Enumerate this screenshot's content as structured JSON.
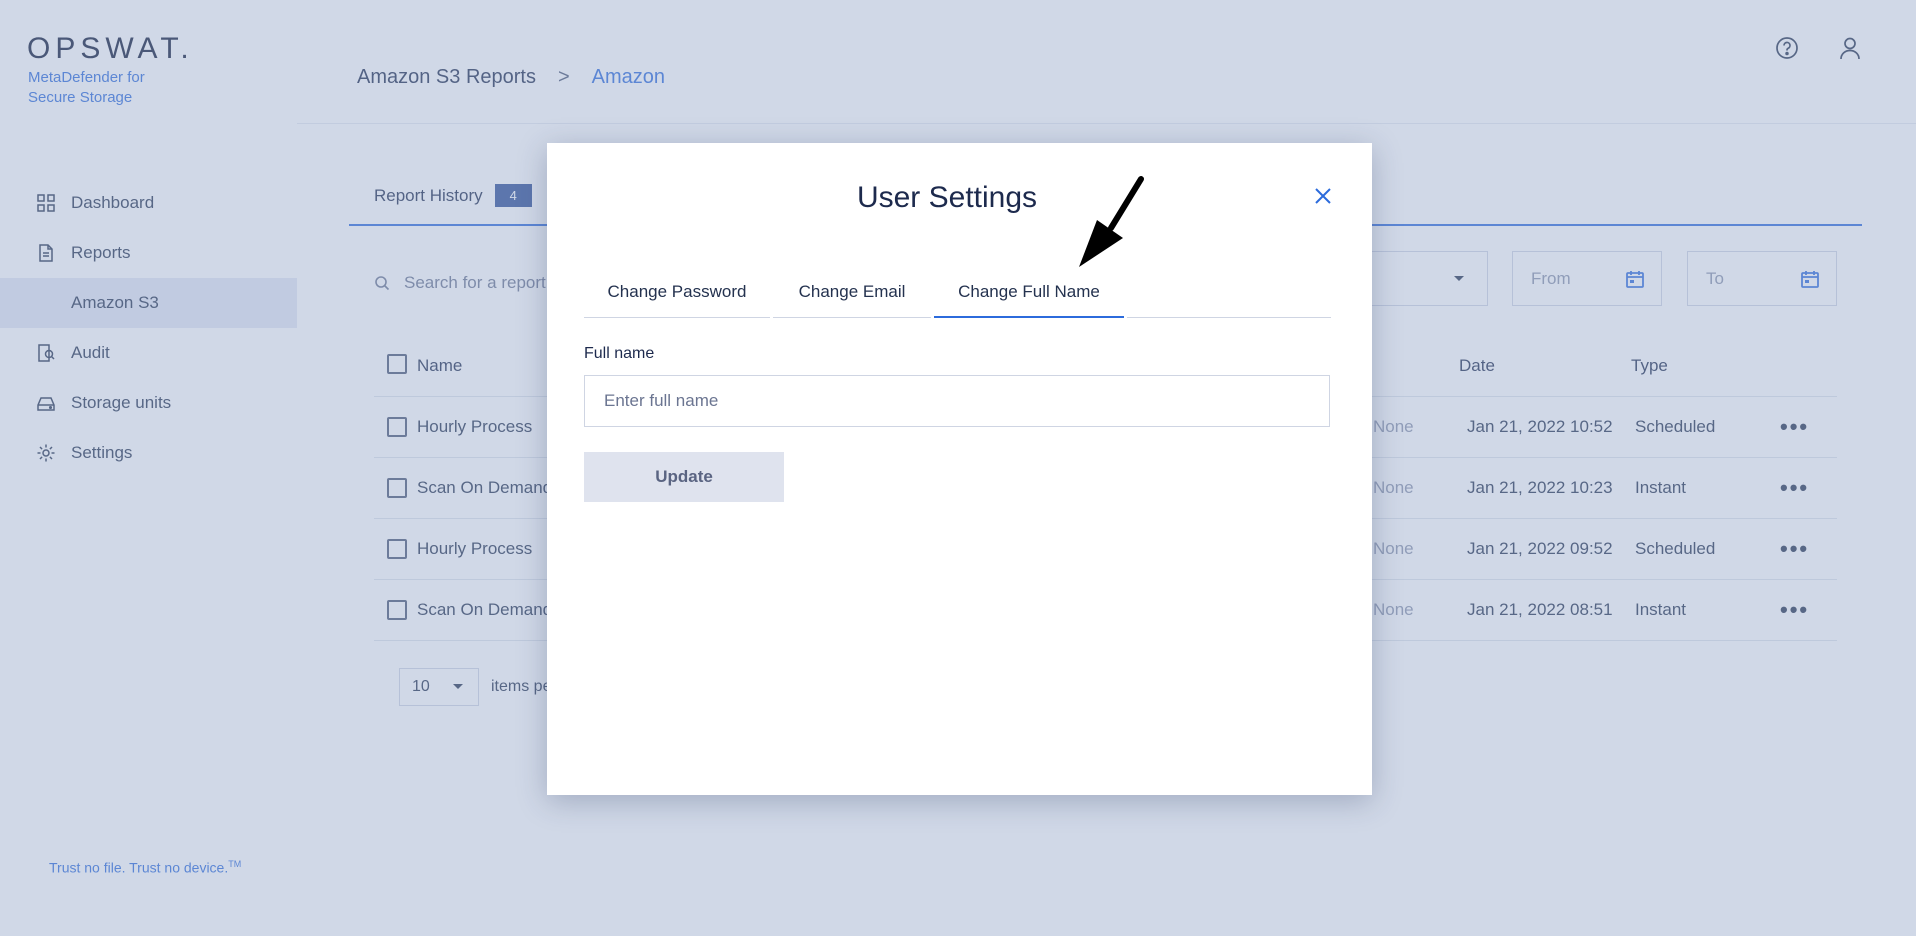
{
  "brand": {
    "logo": "OPSWAT.",
    "product": "MetaDefender for Secure Storage",
    "tagline": "Trust no file. Trust no device.",
    "tagline_mark": "TM",
    "accent_color": "#2c6bdc"
  },
  "sidebar": {
    "items": [
      {
        "label": "Dashboard",
        "icon": "grid-icon"
      },
      {
        "label": "Reports",
        "icon": "document-icon"
      },
      {
        "label": "Amazon S3",
        "icon": ""
      },
      {
        "label": "Audit",
        "icon": "audit-icon"
      },
      {
        "label": "Storage units",
        "icon": "drive-icon"
      },
      {
        "label": "Settings",
        "icon": "gear-icon"
      }
    ]
  },
  "header": {
    "breadcrumb": [
      "Amazon S3 Reports",
      "Amazon"
    ],
    "separator": ">",
    "icons": [
      "help-icon",
      "user-icon"
    ]
  },
  "reports": {
    "tab_label": "Report History",
    "tab_count": "4",
    "search_placeholder": "Search for a report",
    "date_from": "From",
    "date_to": "To",
    "columns": {
      "name": "Name",
      "date": "Date",
      "type": "Type"
    },
    "rows": [
      {
        "name": "Hourly Process",
        "threat": "None",
        "date": "Jan 21, 2022 10:52",
        "type": "Scheduled"
      },
      {
        "name": "Scan On Demand",
        "threat": "None",
        "date": "Jan 21, 2022 10:23",
        "type": "Instant"
      },
      {
        "name": "Hourly Process",
        "threat": "None",
        "date": "Jan 21, 2022 09:52",
        "type": "Scheduled"
      },
      {
        "name": "Scan On Demand",
        "threat": "None",
        "date": "Jan 21, 2022 08:51",
        "type": "Instant"
      }
    ],
    "page_size": "10",
    "page_size_suffix": "items pe"
  },
  "modal": {
    "title": "User Settings",
    "tabs": [
      "Change Password",
      "Change Email",
      "Change Full Name"
    ],
    "active_tab": "Change Full Name",
    "field_label": "Full name",
    "field_placeholder": "Enter full name",
    "field_value": "",
    "submit_label": "Update"
  }
}
